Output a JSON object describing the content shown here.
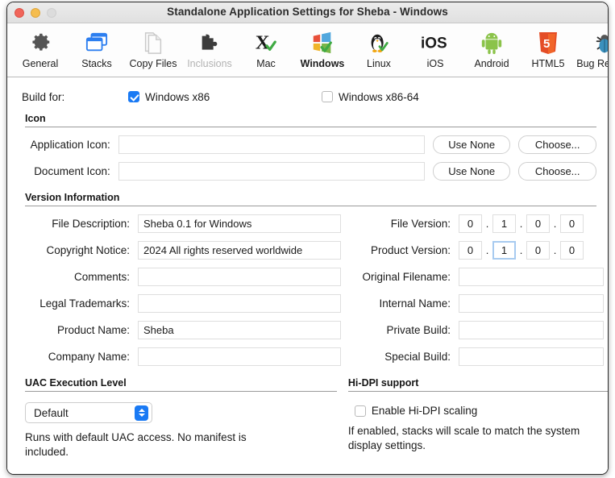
{
  "window": {
    "title": "Standalone Application Settings for Sheba - Windows",
    "traffic_lights": [
      "close-button",
      "minimize-button",
      "zoom-button"
    ]
  },
  "toolbar": {
    "items": [
      {
        "label": "General",
        "icon": "gear-icon",
        "state": "normal"
      },
      {
        "label": "Stacks",
        "icon": "stacks-icon",
        "state": "normal"
      },
      {
        "label": "Copy Files",
        "icon": "documents-icon",
        "state": "normal"
      },
      {
        "label": "Inclusions",
        "icon": "puzzle-icon",
        "state": "disabled"
      },
      {
        "label": "Mac",
        "icon": "mac-x-icon",
        "state": "normal"
      },
      {
        "label": "Windows",
        "icon": "windows-icon",
        "state": "active"
      },
      {
        "label": "Linux",
        "icon": "linux-penguin-icon",
        "state": "normal"
      },
      {
        "label": "iOS",
        "icon": "ios-icon",
        "state": "normal"
      },
      {
        "label": "Android",
        "icon": "android-icon",
        "state": "normal"
      },
      {
        "label": "HTML5",
        "icon": "html5-icon",
        "state": "normal"
      },
      {
        "label": "Bug Reports",
        "icon": "bug-icon",
        "state": "normal"
      }
    ]
  },
  "build_for": {
    "label": "Build for:",
    "options": [
      {
        "label": "Windows x86",
        "checked": true
      },
      {
        "label": "Windows x86-64",
        "checked": false
      }
    ]
  },
  "icon_section": {
    "title": "Icon",
    "rows": [
      {
        "label": "Application Icon:",
        "value": "",
        "use_none": "Use None",
        "choose": "Choose..."
      },
      {
        "label": "Document Icon:",
        "value": "",
        "use_none": "Use None",
        "choose": "Choose..."
      }
    ]
  },
  "version_section": {
    "title": "Version Information",
    "left_fields": [
      {
        "label": "File Description:",
        "value": "Sheba 0.1 for Windows"
      },
      {
        "label": "Copyright Notice:",
        "value": "2024  All rights reserved worldwide"
      },
      {
        "label": "Comments:",
        "value": ""
      },
      {
        "label": "Legal Trademarks:",
        "value": ""
      },
      {
        "label": "Product Name:",
        "value": "Sheba"
      },
      {
        "label": "Company Name:",
        "value": ""
      }
    ],
    "file_version": {
      "label": "File Version:",
      "parts": [
        "0",
        "1",
        "0",
        "0"
      ],
      "focused_index": -1
    },
    "product_version": {
      "label": "Product Version:",
      "parts": [
        "0",
        "1",
        "0",
        "0"
      ],
      "focused_index": 1
    },
    "right_fields": [
      {
        "label": "Original Filename:",
        "value": ""
      },
      {
        "label": "Internal Name:",
        "value": ""
      },
      {
        "label": "Private Build:",
        "value": ""
      },
      {
        "label": "Special Build:",
        "value": ""
      }
    ],
    "separator": "."
  },
  "uac_section": {
    "title": "UAC Execution Level",
    "selected": "Default",
    "description": "Runs with default UAC access. No manifest is included."
  },
  "hidpi_section": {
    "title": "Hi-DPI support",
    "checkbox_label": "Enable Hi-DPI scaling",
    "checked": false,
    "description": "If enabled, stacks will scale to match the system display settings."
  },
  "colors": {
    "accent": "#1a7af4",
    "focus_ring": "#a8cbf0",
    "close": "#f0655a",
    "minimize": "#f5bd4f",
    "zoom": "#dcdcdc"
  }
}
